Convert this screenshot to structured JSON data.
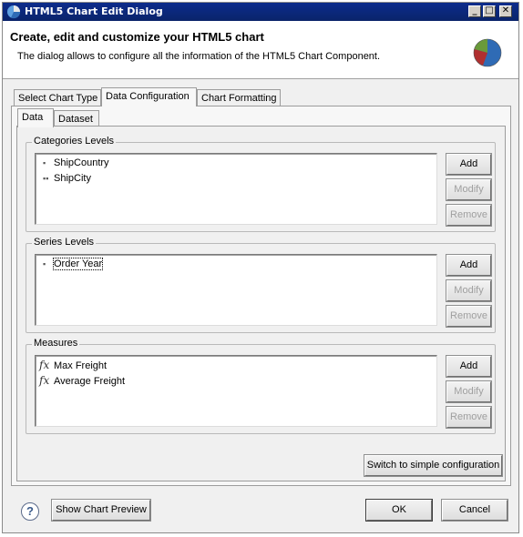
{
  "window": {
    "title": "HTML5 Chart Edit Dialog",
    "minimize_glyph": "_",
    "maximize_glyph": "□",
    "close_glyph": "✕"
  },
  "header": {
    "title": "Create, edit and customize your HTML5 chart",
    "description": "The dialog allows to configure all the information of the HTML5 Chart Component."
  },
  "main_tabs": [
    {
      "label": "Select Chart Type",
      "active": false
    },
    {
      "label": "Data Configuration",
      "active": true
    },
    {
      "label": "Chart Formatting",
      "active": false
    }
  ],
  "sub_tabs": [
    {
      "label": "Data",
      "active": true
    },
    {
      "label": "Dataset",
      "active": false
    }
  ],
  "categories": {
    "legend": "Categories Levels",
    "items": [
      "ShipCountry",
      "ShipCity"
    ],
    "buttons": {
      "add": "Add",
      "modify": "Modify",
      "remove": "Remove"
    }
  },
  "series": {
    "legend": "Series Levels",
    "items": [
      "Order Year"
    ],
    "buttons": {
      "add": "Add",
      "modify": "Modify",
      "remove": "Remove"
    }
  },
  "measures": {
    "legend": "Measures",
    "items": [
      "Max Freight",
      "Average Freight"
    ],
    "buttons": {
      "add": "Add",
      "modify": "Modify",
      "remove": "Remove"
    }
  },
  "switch_button": "Switch to simple configuration",
  "footer": {
    "help_glyph": "?",
    "preview_button": "Show Chart Preview",
    "ok_button": "OK",
    "cancel_button": "Cancel"
  },
  "icons": {
    "app": "chart-app-icon",
    "pie": "pie-chart-icon",
    "level_single": "level-single-icon",
    "level_double": "level-double-icon",
    "measure": "fx-icon",
    "help": "help-icon"
  },
  "colors": {
    "titlebar": "#0a246a",
    "pie_blue": "#2f6bb5",
    "pie_red": "#b03030",
    "pie_green": "#6a9a3a",
    "disabled_text": "#9f9f9f"
  }
}
